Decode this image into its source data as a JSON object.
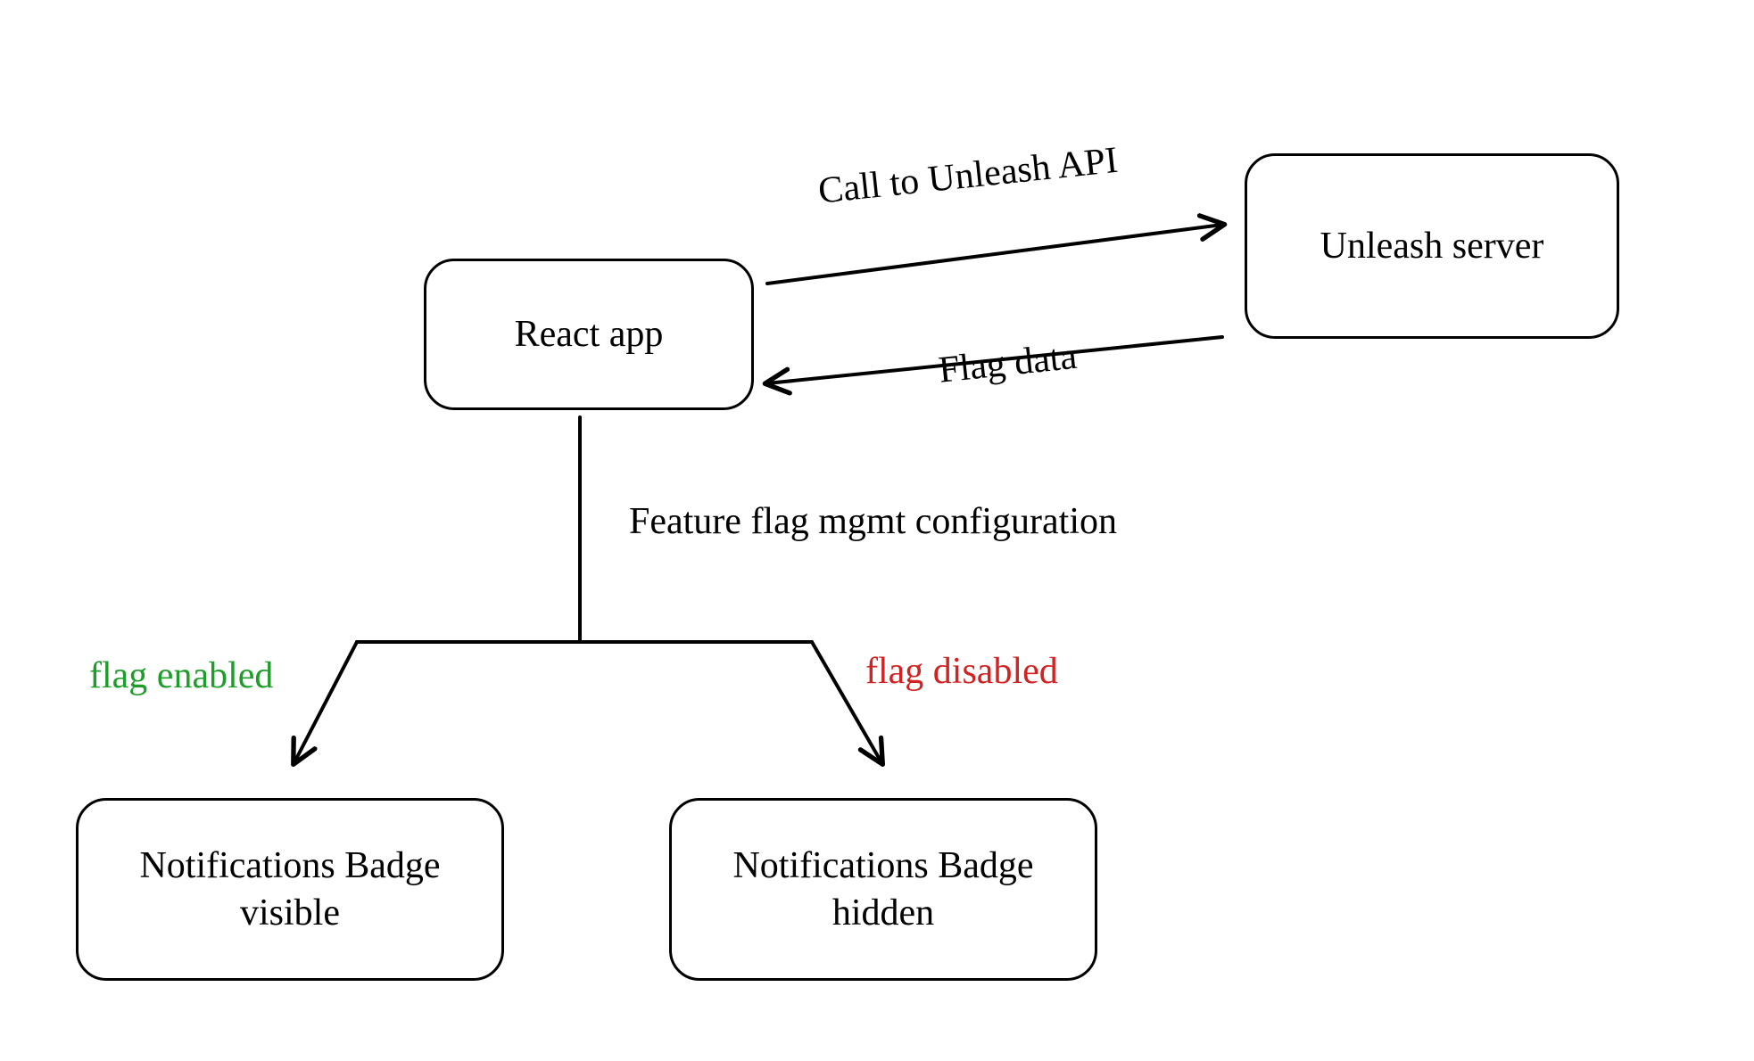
{
  "nodes": {
    "react_app": "React app",
    "unleash_server": "Unleash server",
    "badge_visible": "Notifications Badge\nvisible",
    "badge_hidden": "Notifications Badge\nhidden"
  },
  "edges": {
    "call_api": "Call to Unleash API",
    "flag_data": "Flag data",
    "config": "Feature flag mgmt configuration",
    "flag_enabled": "flag enabled",
    "flag_disabled": "flag disabled"
  },
  "colors": {
    "enabled": "#1f9d2b",
    "disabled": "#d22222",
    "ink": "#000000"
  }
}
